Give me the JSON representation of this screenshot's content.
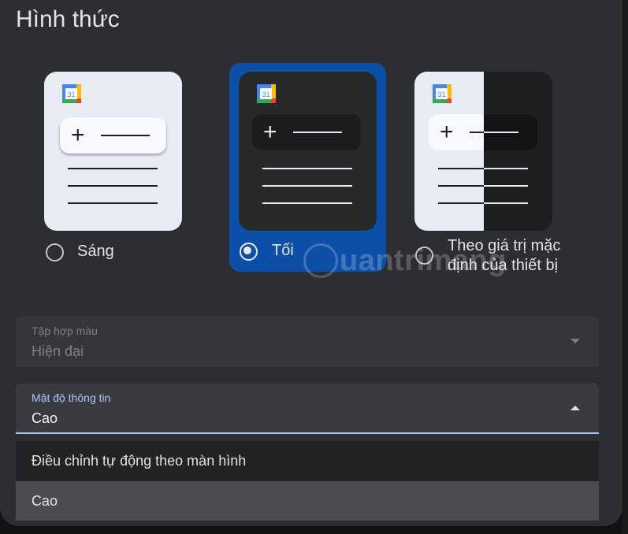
{
  "dialog": {
    "title": "Hình thức"
  },
  "themes": [
    {
      "label": "Sáng",
      "selected": false,
      "icon": "google-calendar-icon"
    },
    {
      "label": "Tối",
      "selected": true,
      "icon": "google-calendar-icon"
    },
    {
      "label_line1": "Theo giá trị mặc",
      "label_line2": "định của thiết bị",
      "selected": false,
      "icon": "google-calendar-icon"
    }
  ],
  "calendar_icon_text": "31",
  "watermark": {
    "text": "uantrimang"
  },
  "color_set": {
    "label": "Tập hợp màu",
    "value": "Hiện đại",
    "disabled": true
  },
  "density": {
    "label": "Mật độ thông tin",
    "value": "Cao",
    "expanded": true
  },
  "density_options": [
    {
      "label": "Điều chỉnh tự động theo màn hình",
      "highlighted": false
    },
    {
      "label": "Cao",
      "highlighted": true
    }
  ],
  "colors": {
    "accent": "#0b4fa8",
    "focus_underline": "#a8c7fa",
    "surface": "#2d2e31"
  }
}
